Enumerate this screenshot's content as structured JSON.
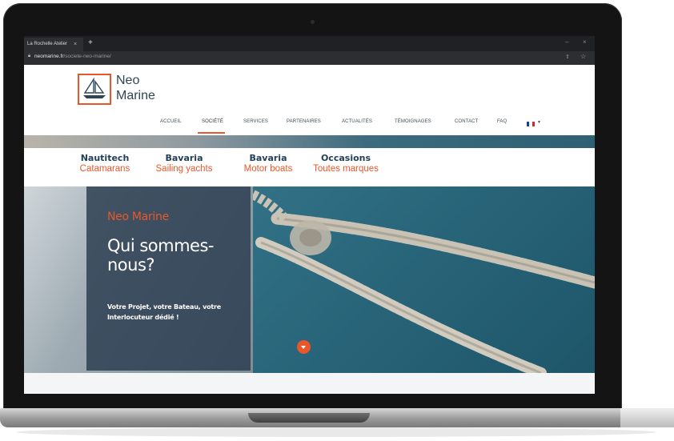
{
  "browser": {
    "tab_title": "La Rochelle Atelier",
    "tab_close": "×",
    "new_tab": "+",
    "url_domain": "neomarine.fr",
    "url_path": "/societe-neo-marine/",
    "minimize": "–",
    "close": "×"
  },
  "site": {
    "logo_line1": "Neo",
    "logo_line2": "Marine",
    "nav": [
      "ACCUEIL",
      "SOCIÉTÉ",
      "SERVICES",
      "PARTENAIRES",
      "ACTUALITÉS",
      "TÉMOIGNAGES",
      "CONTACT",
      "FAQ"
    ],
    "active_nav": "SOCIÉTÉ",
    "accent_color": "#e8572a",
    "navy_color": "#223f57"
  },
  "brands": [
    {
      "name": "Nautitech",
      "sub": "Catamarans"
    },
    {
      "name": "Bavaria",
      "sub": "Sailing yachts"
    },
    {
      "name": "Bavaria",
      "sub": "Motor boats"
    },
    {
      "name": "Occasions",
      "sub": "Toutes marques"
    }
  ],
  "hero": {
    "brand": "Neo Marine",
    "title": "Qui sommes-nous?",
    "subtitle": "Votre Projet, votre Bateau, votre Interlocuteur dédié !"
  }
}
